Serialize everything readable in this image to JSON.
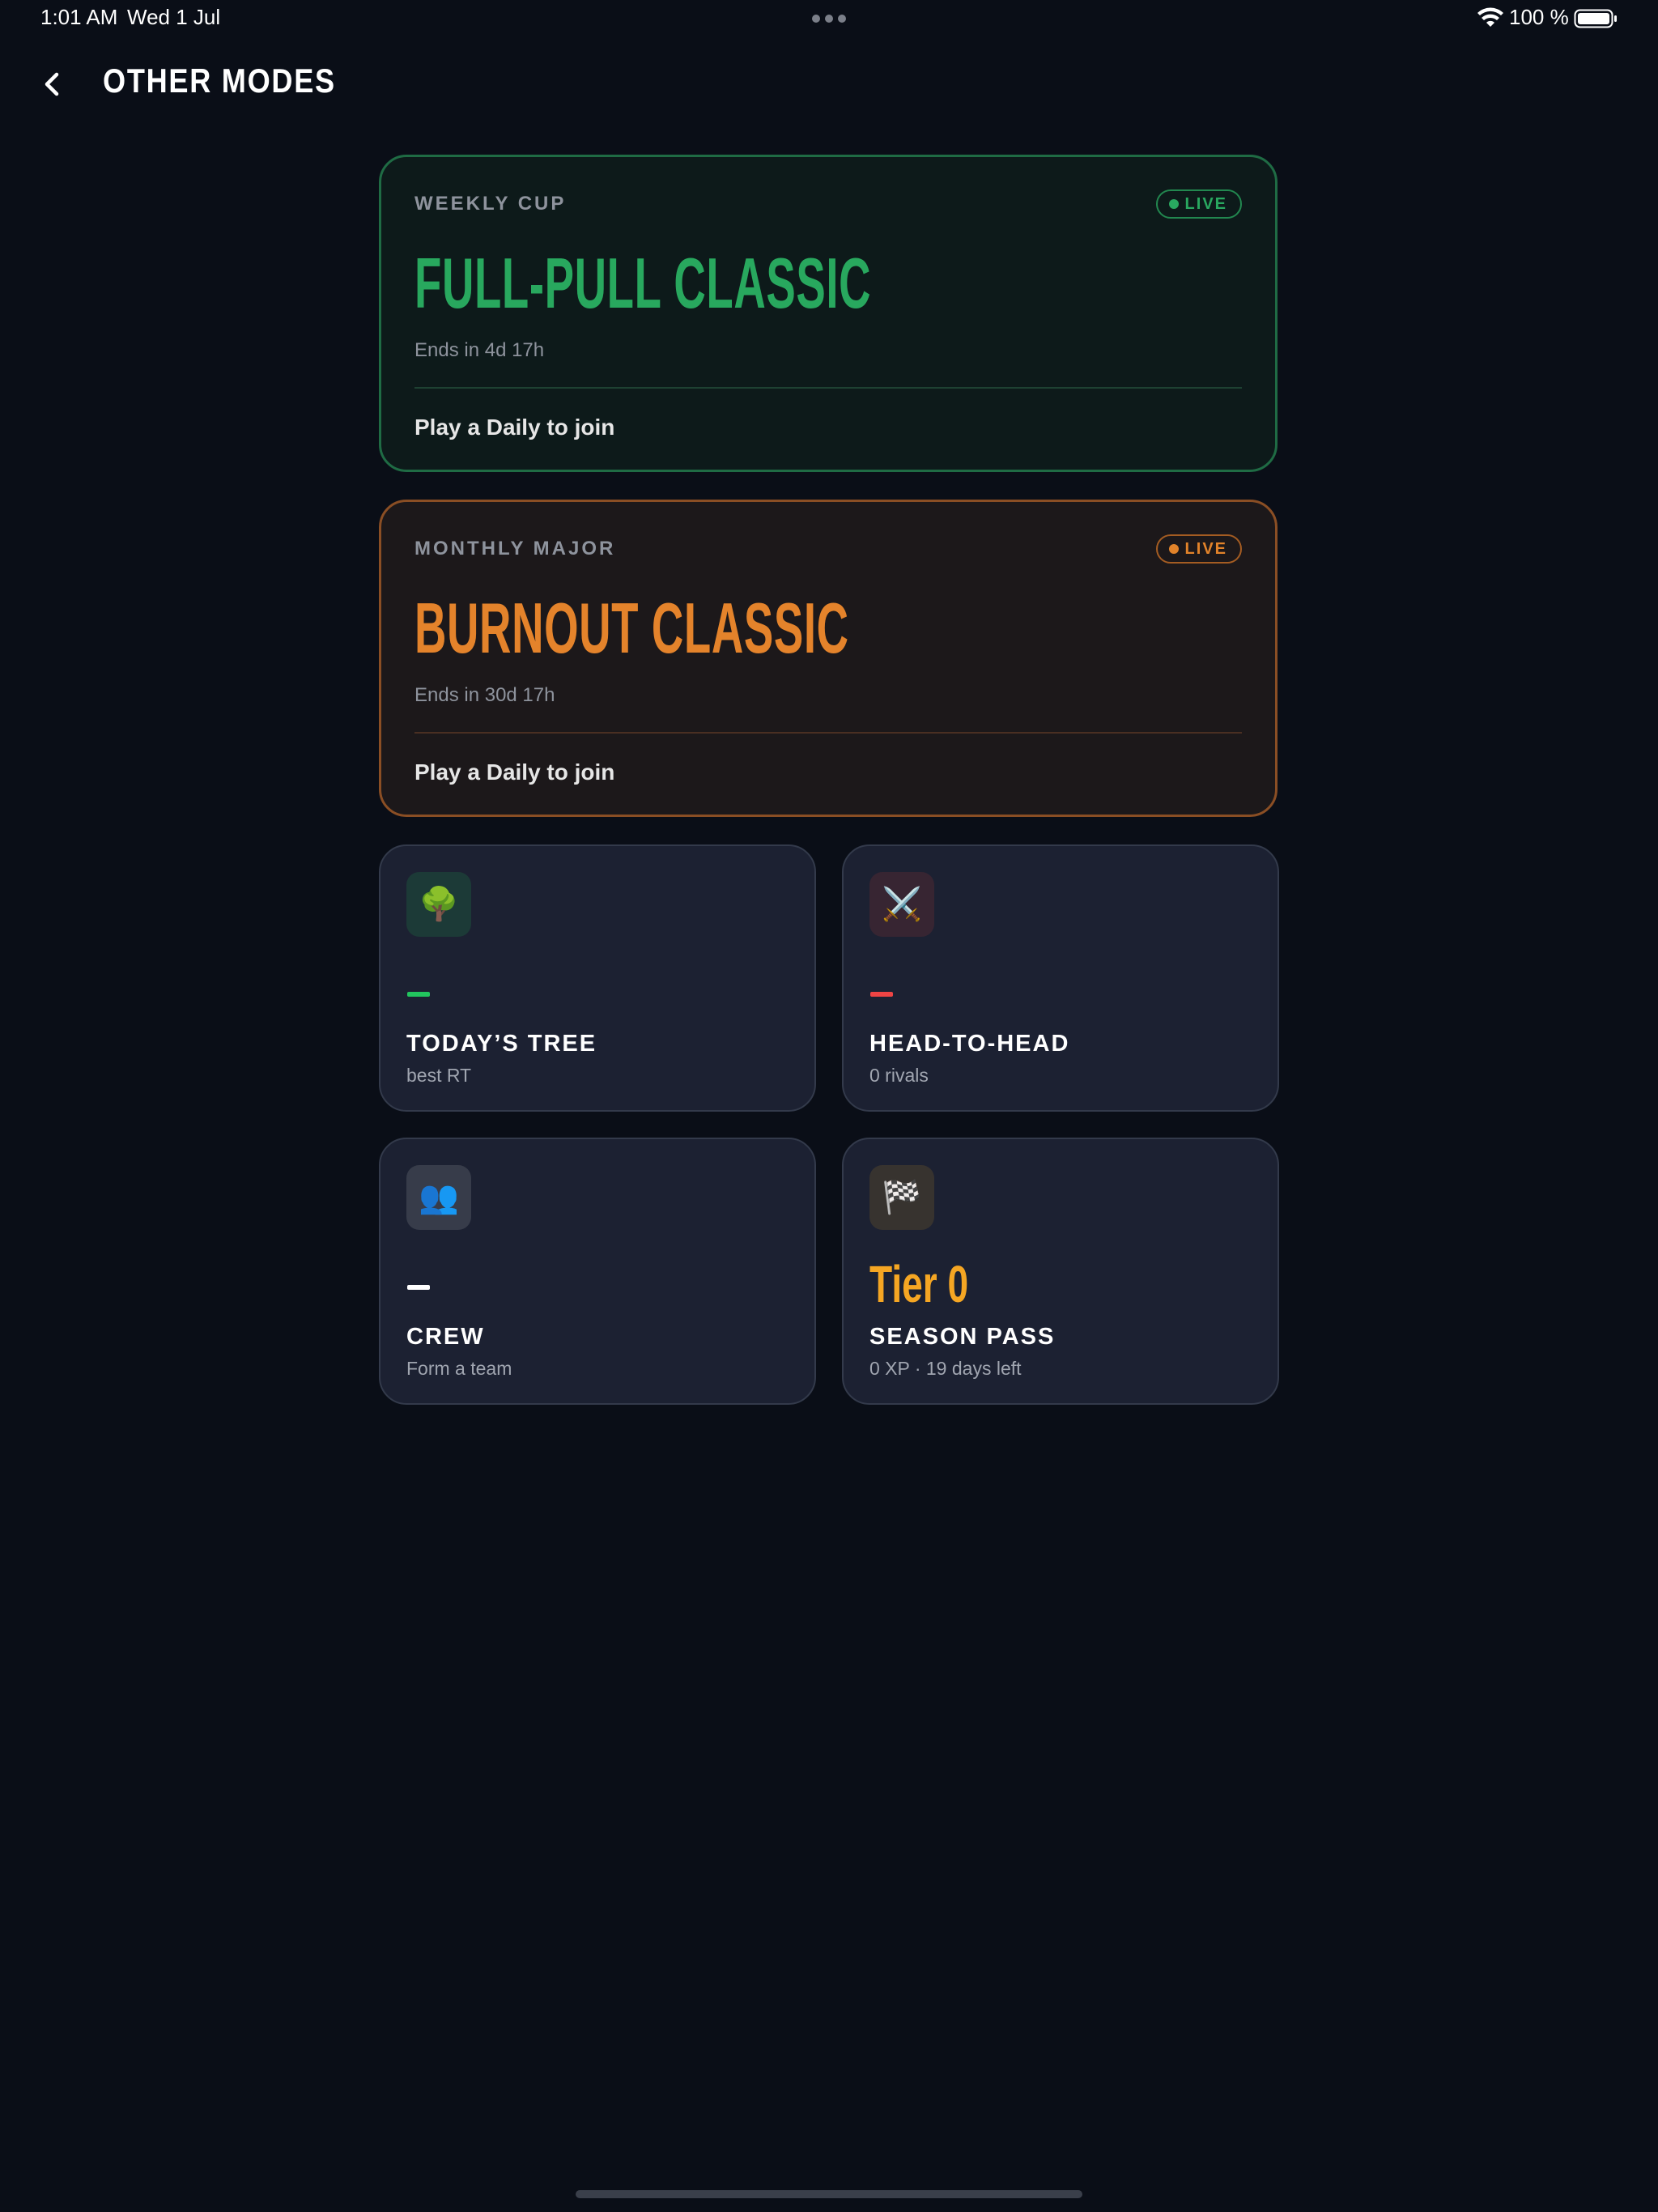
{
  "status_bar": {
    "time": "1:01 AM",
    "date": "Wed 1 Jul",
    "battery": "100 %"
  },
  "header": {
    "back_icon": "chevron-left-icon",
    "title": "OTHER MODES"
  },
  "events": [
    {
      "label": "WEEKLY CUP",
      "badge": "LIVE",
      "title": "FULL-PULL CLASSIC",
      "ends": "Ends in 4d 17h",
      "cta": "Play a Daily to join",
      "accent": "#28a85e"
    },
    {
      "label": "MONTHLY MAJOR",
      "badge": "LIVE",
      "title": "BURNOUT CLASSIC",
      "ends": "Ends in 30d 17h",
      "cta": "Play a Daily to join",
      "accent": "#e4832b"
    }
  ],
  "tiles": [
    {
      "icon": "🌳",
      "icon_name": "tree-icon",
      "value": "—",
      "value_color": "#22c55e",
      "title": "TODAY’S TREE",
      "subtitle": "best RT"
    },
    {
      "icon": "⚔️",
      "icon_name": "crossed-swords-icon",
      "value": "—",
      "value_color": "#ef4444",
      "title": "HEAD-TO-HEAD",
      "subtitle": "0 rivals"
    },
    {
      "icon": "👥",
      "icon_name": "people-icon",
      "value": "—",
      "value_color": "#ffffff",
      "title": "CREW",
      "subtitle": "Form a team"
    },
    {
      "icon": "🏁",
      "icon_name": "checkered-flag-icon",
      "value": "Tier 0",
      "value_color": "#f5a623",
      "title": "SEASON PASS",
      "subtitle": "0 XP · 19 days left"
    }
  ]
}
